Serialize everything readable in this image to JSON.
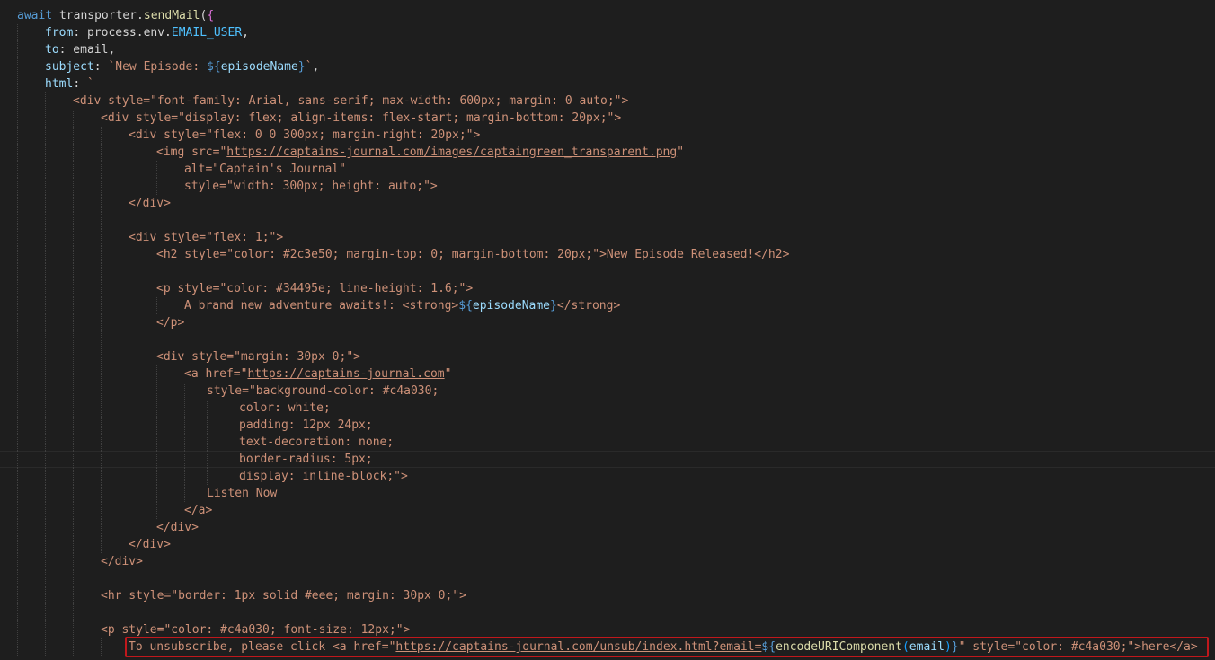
{
  "editor": {
    "lines": [
      {
        "indent": 0,
        "tokens": [
          {
            "t": "await",
            "c": "kw"
          },
          {
            "t": " transporter.",
            "c": "txt"
          },
          {
            "t": "sendMail",
            "c": "fn"
          },
          {
            "t": "(",
            "c": "punc"
          },
          {
            "t": "{",
            "c": "brace"
          }
        ]
      },
      {
        "indent": 1,
        "tokens": [
          {
            "t": "from",
            "c": "prop"
          },
          {
            "t": ": process.env.",
            "c": "txt"
          },
          {
            "t": "EMAIL_USER",
            "c": "env"
          },
          {
            "t": ",",
            "c": "punc"
          }
        ]
      },
      {
        "indent": 1,
        "tokens": [
          {
            "t": "to",
            "c": "prop"
          },
          {
            "t": ": email,",
            "c": "txt"
          }
        ]
      },
      {
        "indent": 1,
        "tokens": [
          {
            "t": "subject",
            "c": "prop"
          },
          {
            "t": ": ",
            "c": "txt"
          },
          {
            "t": "`New Episode: ",
            "c": "str"
          },
          {
            "t": "${",
            "c": "interp"
          },
          {
            "t": "episodeName",
            "c": "var"
          },
          {
            "t": "}",
            "c": "interp"
          },
          {
            "t": "`",
            "c": "str"
          },
          {
            "t": ",",
            "c": "punc"
          }
        ]
      },
      {
        "indent": 1,
        "tokens": [
          {
            "t": "html",
            "c": "prop"
          },
          {
            "t": ": ",
            "c": "txt"
          },
          {
            "t": "`",
            "c": "str"
          }
        ]
      },
      {
        "indent": 2,
        "tokens": [
          {
            "t": "<div style=\"font-family: Arial, sans-serif; max-width: 600px; margin: 0 auto;\">",
            "c": "str"
          }
        ]
      },
      {
        "indent": 3,
        "tokens": [
          {
            "t": "<div style=\"display: flex; align-items: flex-start; margin-bottom: 20px;\">",
            "c": "str"
          }
        ]
      },
      {
        "indent": 4,
        "tokens": [
          {
            "t": "<div style=\"flex: 0 0 300px; margin-right: 20px;\">",
            "c": "str"
          }
        ]
      },
      {
        "indent": 5,
        "tokens": [
          {
            "t": "<img src=\"",
            "c": "str"
          },
          {
            "t": "https://captains-journal.com/images/captaingreen_transparent.png",
            "c": "url"
          },
          {
            "t": "\"",
            "c": "str"
          }
        ]
      },
      {
        "indent": 6,
        "tokens": [
          {
            "t": "alt=\"Captain's Journal\"",
            "c": "str"
          }
        ]
      },
      {
        "indent": 6,
        "tokens": [
          {
            "t": "style=\"width: 300px; height: auto;\">",
            "c": "str"
          }
        ]
      },
      {
        "indent": 4,
        "tokens": [
          {
            "t": "</div>",
            "c": "str"
          }
        ]
      },
      {
        "indent": 4,
        "tokens": []
      },
      {
        "indent": 4,
        "tokens": [
          {
            "t": "<div style=\"flex: 1;\">",
            "c": "str"
          }
        ]
      },
      {
        "indent": 5,
        "tokens": [
          {
            "t": "<h2 style=\"color: #2c3e50; margin-top: 0; margin-bottom: 20px;\">New Episode Released!</h2>",
            "c": "str"
          }
        ]
      },
      {
        "indent": 5,
        "tokens": []
      },
      {
        "indent": 5,
        "tokens": [
          {
            "t": "<p style=\"color: #34495e; line-height: 1.6;\">",
            "c": "str"
          }
        ]
      },
      {
        "indent": 6,
        "tokens": [
          {
            "t": "A brand new adventure awaits!: <strong>",
            "c": "str"
          },
          {
            "t": "${",
            "c": "interp"
          },
          {
            "t": "episodeName",
            "c": "var"
          },
          {
            "t": "}",
            "c": "interp"
          },
          {
            "t": "</strong>",
            "c": "str"
          }
        ]
      },
      {
        "indent": 5,
        "tokens": [
          {
            "t": "</p>",
            "c": "str"
          }
        ]
      },
      {
        "indent": 5,
        "tokens": []
      },
      {
        "indent": 5,
        "tokens": [
          {
            "t": "<div style=\"margin: 30px 0;\">",
            "c": "str"
          }
        ]
      },
      {
        "indent": 6,
        "tokens": [
          {
            "t": "<a href=\"",
            "c": "str"
          },
          {
            "t": "https://captains-journal.com",
            "c": "url"
          },
          {
            "t": "\"",
            "c": "str"
          }
        ]
      },
      {
        "indent": 7,
        "tokens": [
          {
            "t": "style=\"background-color: #c4a030;",
            "c": "str"
          }
        ]
      },
      {
        "indent": 8,
        "tokens": [
          {
            "t": "color: white;",
            "c": "str"
          }
        ]
      },
      {
        "indent": 8,
        "tokens": [
          {
            "t": "padding: 12px 24px;",
            "c": "str"
          }
        ]
      },
      {
        "indent": 8,
        "tokens": [
          {
            "t": "text-decoration: none;",
            "c": "str"
          }
        ]
      },
      {
        "indent": 8,
        "current": true,
        "tokens": [
          {
            "t": "border-radius: 5px;",
            "c": "str"
          }
        ]
      },
      {
        "indent": 8,
        "tokens": [
          {
            "t": "display: inline-block;\">",
            "c": "str"
          }
        ]
      },
      {
        "indent": 7,
        "tokens": [
          {
            "t": "Listen Now",
            "c": "str"
          }
        ]
      },
      {
        "indent": 6,
        "tokens": [
          {
            "t": "</a>",
            "c": "str"
          }
        ]
      },
      {
        "indent": 5,
        "tokens": [
          {
            "t": "</div>",
            "c": "str"
          }
        ]
      },
      {
        "indent": 4,
        "tokens": [
          {
            "t": "</div>",
            "c": "str"
          }
        ]
      },
      {
        "indent": 3,
        "tokens": [
          {
            "t": "</div>",
            "c": "str"
          }
        ]
      },
      {
        "indent": 3,
        "tokens": []
      },
      {
        "indent": 3,
        "tokens": [
          {
            "t": "<hr style=\"border: 1px solid #eee; margin: 30px 0;\">",
            "c": "str"
          }
        ]
      },
      {
        "indent": 3,
        "tokens": []
      },
      {
        "indent": 3,
        "tokens": [
          {
            "t": "<p style=\"color: #c4a030; font-size: 12px;\">",
            "c": "str"
          }
        ]
      },
      {
        "indent": 4,
        "highlighted": true,
        "tokens": [
          {
            "t": "To unsubscribe, please click <a href=\"",
            "c": "str"
          },
          {
            "t": "https://captains-journal.com/unsub/index.html?email=",
            "c": "url"
          },
          {
            "t": "${",
            "c": "interp"
          },
          {
            "t": "encodeURIComponent",
            "c": "fn"
          },
          {
            "t": "(",
            "c": "brace2"
          },
          {
            "t": "email",
            "c": "var"
          },
          {
            "t": ")",
            "c": "brace2"
          },
          {
            "t": "}",
            "c": "interp"
          },
          {
            "t": "\" style=\"color: #c4a030;\">here</a>",
            "c": "str"
          }
        ]
      }
    ]
  }
}
